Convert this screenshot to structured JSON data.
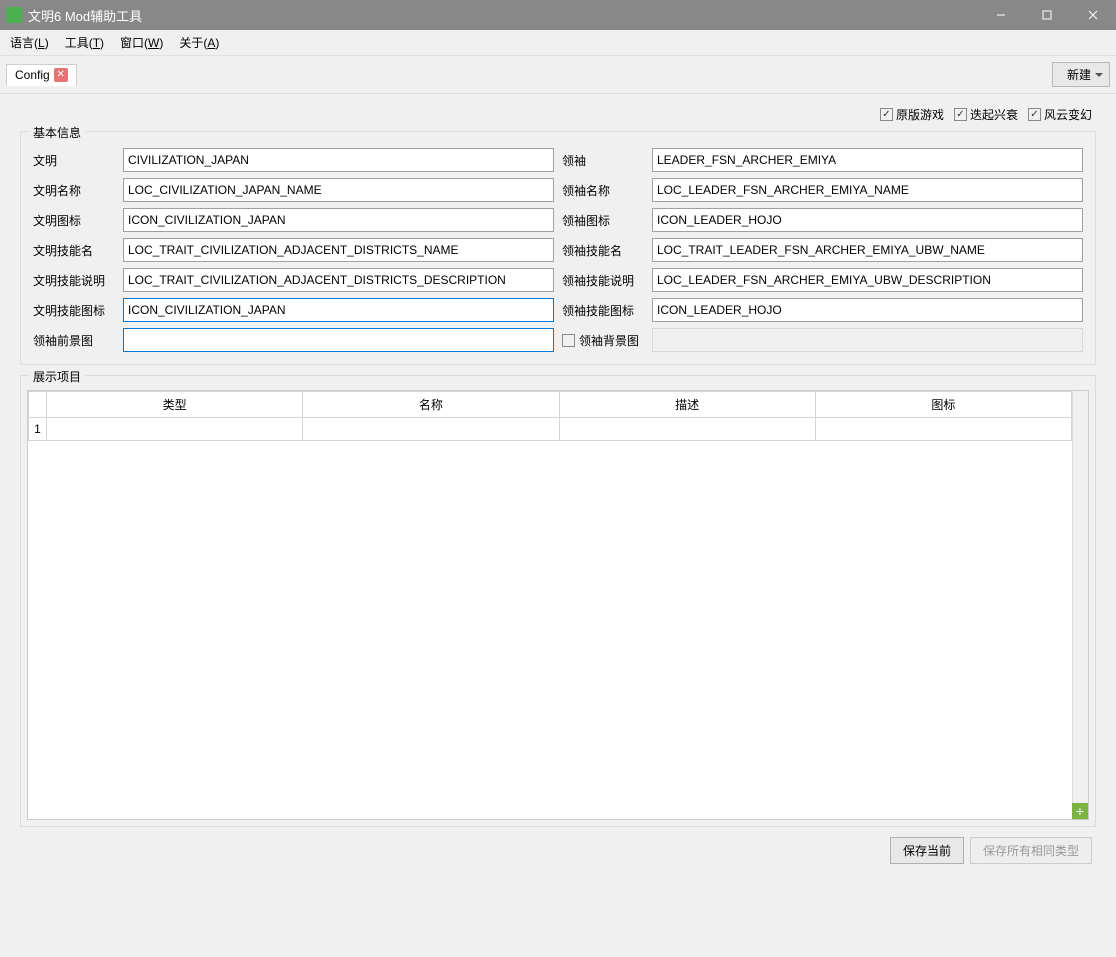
{
  "window": {
    "title": "文明6 Mod辅助工具"
  },
  "menu": {
    "language": {
      "pre": "语言(",
      "u": "L",
      "post": ")"
    },
    "tool": {
      "pre": "工具(",
      "u": "T",
      "post": ")"
    },
    "window": {
      "pre": "窗口(",
      "u": "W",
      "post": ")"
    },
    "about": {
      "pre": "关于(",
      "u": "A",
      "post": ")"
    }
  },
  "tab": {
    "label": "Config"
  },
  "newButton": "新建",
  "options": {
    "vanilla": {
      "label": "原版游戏",
      "checked": true
    },
    "rise": {
      "label": "迭起兴衰",
      "checked": true
    },
    "storm": {
      "label": "风云变幻",
      "checked": true
    }
  },
  "basicInfo": {
    "legend": "基本信息",
    "rows": [
      {
        "l1": "文明",
        "v1": "CIVILIZATION_JAPAN",
        "l2": "领袖",
        "v2": "LEADER_FSN_ARCHER_EMIYA"
      },
      {
        "l1": "文明名称",
        "v1": "LOC_CIVILIZATION_JAPAN_NAME",
        "l2": "领袖名称",
        "v2": "LOC_LEADER_FSN_ARCHER_EMIYA_NAME"
      },
      {
        "l1": "文明图标",
        "v1": "ICON_CIVILIZATION_JAPAN",
        "l2": "领袖图标",
        "v2": "ICON_LEADER_HOJO"
      },
      {
        "l1": "文明技能名",
        "v1": "LOC_TRAIT_CIVILIZATION_ADJACENT_DISTRICTS_NAME",
        "l2": "领袖技能名",
        "v2": "LOC_TRAIT_LEADER_FSN_ARCHER_EMIYA_UBW_NAME"
      },
      {
        "l1": "文明技能说明",
        "v1": "LOC_TRAIT_CIVILIZATION_ADJACENT_DISTRICTS_DESCRIPTION",
        "l2": "领袖技能说明",
        "v2": "LOC_LEADER_FSN_ARCHER_EMIYA_UBW_DESCRIPTION"
      },
      {
        "l1": "文明技能图标",
        "v1": "ICON_CIVILIZATION_JAPAN",
        "l2": "领袖技能图标",
        "v2": "ICON_LEADER_HOJO"
      }
    ],
    "lastRow": {
      "l1": "领袖前景图",
      "v1": "",
      "checkboxLabel": "领袖背景图",
      "v2": ""
    }
  },
  "display": {
    "legend": "展示项目",
    "headers": [
      "类型",
      "名称",
      "描述",
      "图标"
    ],
    "rows": [
      {
        "n": "1",
        "c0": "",
        "c1": "",
        "c2": "",
        "c3": ""
      }
    ]
  },
  "footer": {
    "save": "保存当前",
    "saveAll": "保存所有相同类型"
  }
}
